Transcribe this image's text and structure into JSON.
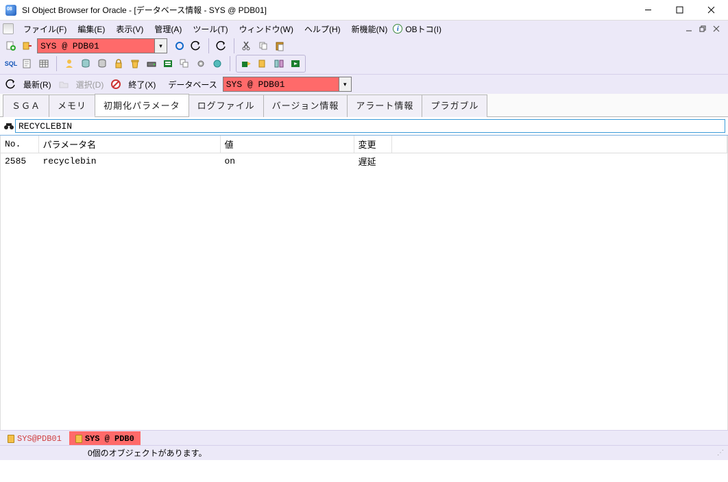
{
  "window": {
    "title": "SI Object Browser for Oracle - [データベース情報 - SYS @ PDB01]"
  },
  "menu": {
    "file": "ファイル(F)",
    "edit": "編集(E)",
    "view": "表示(V)",
    "admin": "管理(A)",
    "tool": "ツール(T)",
    "window": "ウィンドウ(W)",
    "help": "ヘルプ(H)",
    "newfeat": "新機能(N)",
    "obtoko": "OBトコ(I)"
  },
  "toolbar": {
    "connection": "SYS @ PDB01"
  },
  "actionbar": {
    "refresh": "最新(R)",
    "select": "選択(D)",
    "exit": "終了(X)",
    "database_lbl": "データベース",
    "database_val": "SYS @ PDB01"
  },
  "tabs": {
    "t1": "ＳＧＡ",
    "t2": "メモリ",
    "t3": "初期化パラメータ",
    "t4": "ログファイル",
    "t5": "バージョン情報",
    "t6": "アラート情報",
    "t7": "プラガブル"
  },
  "search": {
    "value": "RECYCLEBIN"
  },
  "grid": {
    "headers": {
      "no": "No.",
      "name": "パラメータ名",
      "value": "値",
      "change": "変更"
    },
    "rows": [
      {
        "no": "2585",
        "name": "recyclebin",
        "value": "on",
        "change": "遅延"
      }
    ]
  },
  "bottom_tabs": {
    "t1": "SYS@PDB01",
    "t2": "SYS @ PDB0"
  },
  "status": {
    "msg": "0個のオブジェクトがあります。"
  }
}
